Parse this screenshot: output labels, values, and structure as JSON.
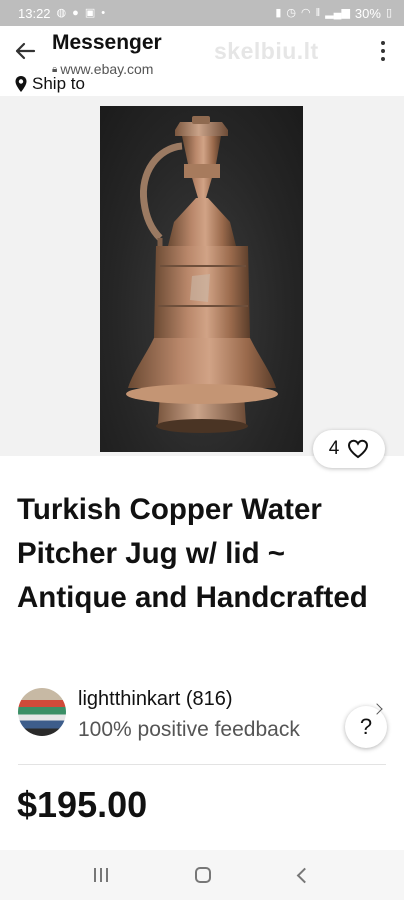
{
  "status_bar": {
    "time": "13:22",
    "battery": "30%",
    "notification_icons": [
      "messenger-icon",
      "chat-icon",
      "gmail-icon",
      "dot-icon"
    ],
    "system_icons": [
      "battery-saver-icon",
      "alarm-icon",
      "wifi-icon",
      "volte-icon",
      "signal-icon",
      "battery-icon"
    ]
  },
  "header": {
    "title": "Messenger",
    "url": "www.ebay.com",
    "watermark": "skelbiu.lt"
  },
  "ship_to": {
    "label": "Ship to"
  },
  "listing": {
    "favorites_count": "4",
    "title": "Turkish Copper Water Pitcher Jug w/ lid ~ Antique and Handcrafted",
    "price": "$195.00"
  },
  "seller": {
    "name": "lightthinkart (816)",
    "feedback": "100% positive feedback"
  },
  "help_button": {
    "label": "?"
  },
  "colors": {
    "status_bar": "#bdbdbd",
    "image_background": "#f2f2f2",
    "text_primary": "#111111",
    "text_secondary": "#555555"
  }
}
